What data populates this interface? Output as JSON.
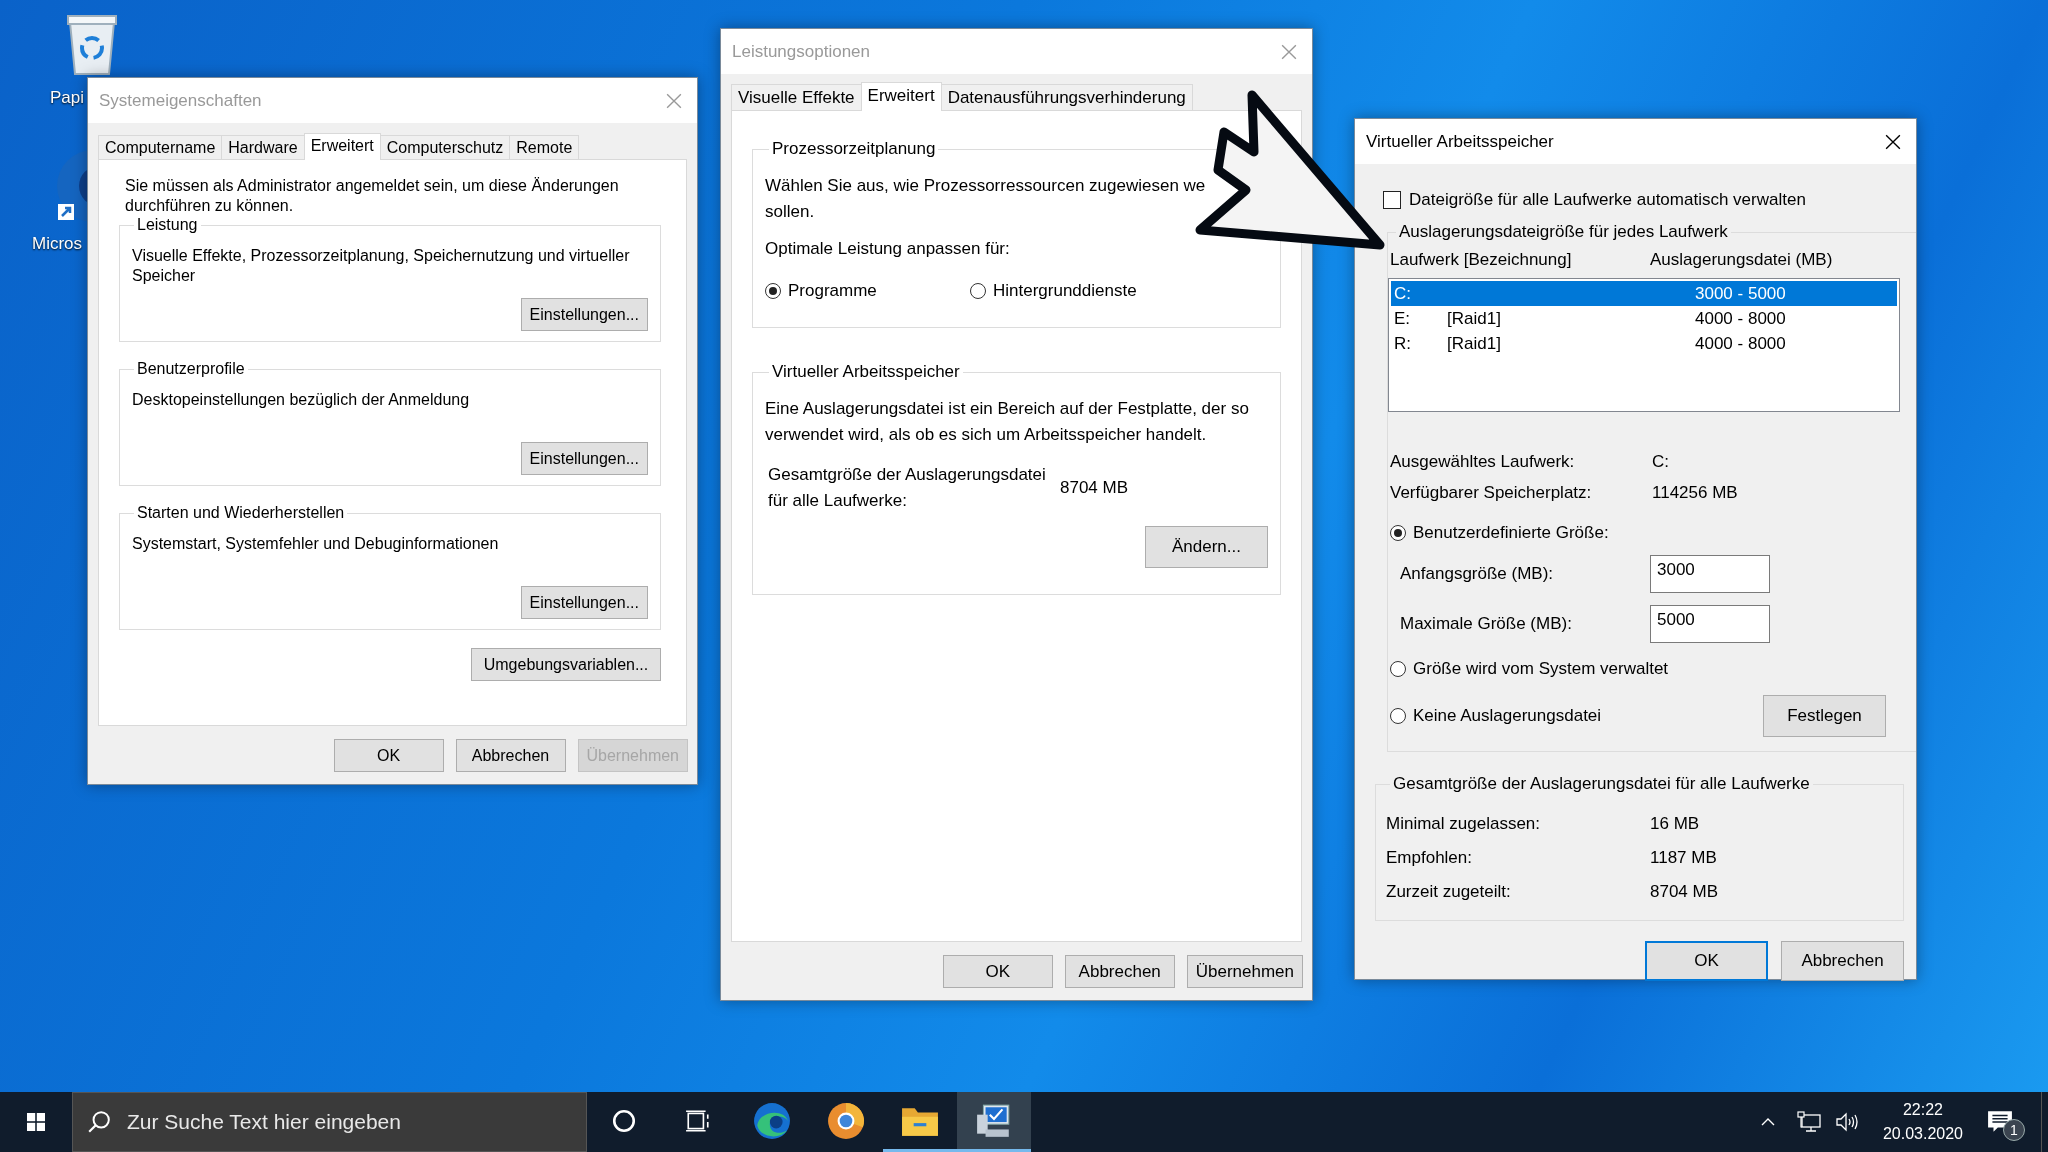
{
  "desktop_icons": [
    {
      "label": "Papi",
      "kind": "bin"
    },
    {
      "label": "Micros",
      "kind": "shortcut"
    }
  ],
  "system_properties": {
    "title": "Systemeigenschaften",
    "active": false,
    "tabs": [
      {
        "label": "Computername",
        "selected": false
      },
      {
        "label": "Hardware",
        "selected": false
      },
      {
        "label": "Erweitert",
        "selected": true
      },
      {
        "label": "Computerschutz",
        "selected": false
      },
      {
        "label": "Remote",
        "selected": false
      }
    ],
    "note": "Sie müssen als Administrator angemeldet sein, um diese Änderungen durchführen zu können.",
    "groups": [
      {
        "title": "Leistung",
        "text": "Visuelle Effekte, Prozessorzeitplanung, Speichernutzung und virtueller Speicher",
        "button": "Einstellungen..."
      },
      {
        "title": "Benutzerprofile",
        "text": "Desktopeinstellungen bezüglich der Anmeldung",
        "button": "Einstellungen..."
      },
      {
        "title": "Starten und Wiederherstellen",
        "text": "Systemstart, Systemfehler und Debuginformationen",
        "button": "Einstellungen..."
      }
    ],
    "env_button": "Umgebungsvariablen...",
    "buttons": [
      {
        "label": "OK",
        "disabled": false
      },
      {
        "label": "Abbrechen",
        "disabled": false
      },
      {
        "label": "Übernehmen",
        "disabled": true
      }
    ]
  },
  "performance_options": {
    "title": "Leistungsoptionen",
    "active": false,
    "tabs": [
      {
        "label": "Visuelle Effekte",
        "selected": false
      },
      {
        "label": "Erweitert",
        "selected": true
      },
      {
        "label": "Datenausführungsverhinderung",
        "selected": false
      }
    ],
    "scheduling": {
      "title": "Prozessorzeitplanung",
      "text_lines": [
        "Wählen Sie aus, wie Prozessorressourcen zugewiesen we",
        "sollen."
      ],
      "prompt": "Optimale Leistung anpassen für:",
      "options": [
        {
          "label": "Programme",
          "selected": true
        },
        {
          "label": "Hintergrunddienste",
          "selected": false
        }
      ]
    },
    "virtual_memory": {
      "title": "Virtueller Arbeitsspeicher",
      "text": "Eine Auslagerungsdatei ist ein Bereich auf der Festplatte, der so verwendet wird, als ob es sich um Arbeitsspeicher handelt.",
      "total_label_lines": [
        "Gesamtgröße der Auslagerungsdatei",
        "für alle Laufwerke:"
      ],
      "total_value": "8704 MB",
      "button": "Ändern..."
    },
    "buttons": [
      {
        "label": "OK",
        "disabled": false
      },
      {
        "label": "Abbrechen",
        "disabled": false
      },
      {
        "label": "Übernehmen",
        "disabled": false
      }
    ]
  },
  "virtual_memory": {
    "title": "Virtueller Arbeitsspeicher",
    "active": true,
    "auto_manage": {
      "label": "Dateigröße für alle Laufwerke automatisch verwalten",
      "checked": false
    },
    "drives_group": {
      "title": "Auslagerungsdateigröße für jedes Laufwerk",
      "columns": [
        "Laufwerk [Bezeichnung]",
        "Auslagerungsdatei (MB)"
      ],
      "rows": [
        {
          "drive": "C:",
          "size": "3000 - 5000",
          "selected": true
        },
        {
          "drive": "E:",
          "label": "[Raid1]",
          "size": "4000 - 8000",
          "selected": false
        },
        {
          "drive": "R:",
          "label": "[Raid1]",
          "size": "4000 - 8000",
          "selected": false
        }
      ],
      "info": [
        {
          "label": "Ausgewähltes Laufwerk:",
          "value": "C:"
        },
        {
          "label": "Verfügbarer Speicherplatz:",
          "value": "114256 MB"
        }
      ],
      "options": [
        {
          "label": "Benutzerdefinierte Größe:",
          "selected": true,
          "fields": [
            {
              "label": "Anfangsgröße (MB):",
              "value": "3000"
            },
            {
              "label": "Maximale Größe (MB):",
              "value": "5000"
            }
          ]
        },
        {
          "label": "Größe wird vom System verwaltet",
          "selected": false
        },
        {
          "label": "Keine Auslagerungsdatei",
          "selected": false
        }
      ],
      "set_button": "Festlegen"
    },
    "totals": {
      "title": "Gesamtgröße der Auslagerungsdatei für alle Laufwerke",
      "rows": [
        {
          "label": "Minimal zugelassen:",
          "value": "16 MB"
        },
        {
          "label": "Empfohlen:",
          "value": "1187 MB"
        },
        {
          "label": "Zurzeit zugeteilt:",
          "value": "8704 MB"
        }
      ]
    },
    "buttons": [
      {
        "label": "OK",
        "default": true
      },
      {
        "label": "Abbrechen",
        "default": false
      }
    ]
  },
  "taskbar": {
    "search_placeholder": "Zur Suche Text hier eingeben",
    "apps": [
      {
        "kind": "cortana",
        "running": false,
        "selected": false
      },
      {
        "kind": "taskview",
        "running": false,
        "selected": false
      },
      {
        "kind": "edge",
        "running": false,
        "selected": false
      },
      {
        "kind": "chrome",
        "running": false,
        "selected": false
      },
      {
        "kind": "explorer",
        "running": true,
        "selected": false
      },
      {
        "kind": "system",
        "running": true,
        "selected": true
      }
    ],
    "time": "22:22",
    "date": "20.03.2020",
    "notification_count": "1"
  }
}
